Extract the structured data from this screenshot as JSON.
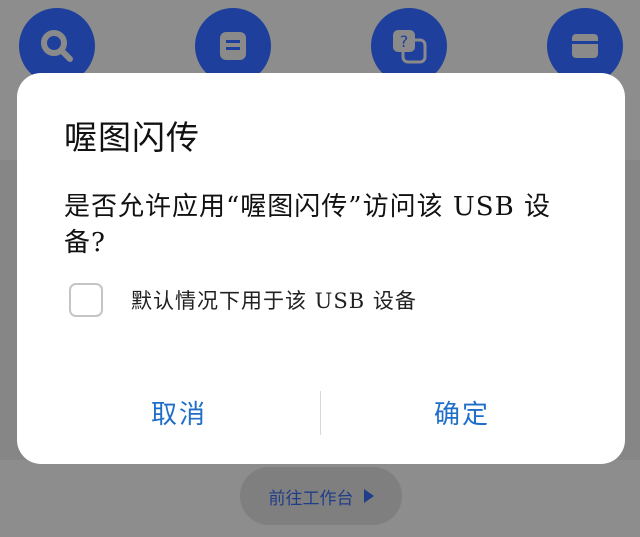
{
  "dialog": {
    "title": "喔图闪传",
    "message": "是否允许应用“喔图闪传”访问该 USB 设备?",
    "checkbox_label": "默认情况下用于该 USB 设备",
    "checkbox_checked": false,
    "cancel_label": "取消",
    "confirm_label": "确定",
    "accent_color": "#1f6fc9"
  },
  "background": {
    "icons": [
      "search-icon",
      "document-icon",
      "help-chat-icon",
      "box-icon"
    ],
    "workbench_label": "前往工作台",
    "icon_color": "#1f3f9d"
  }
}
